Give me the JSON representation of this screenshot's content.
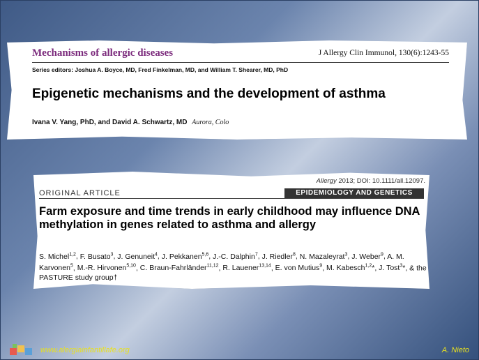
{
  "clip1": {
    "journal": "Mechanisms of allergic diseases",
    "citation": "J Allergy Clin Immunol, 130(6):1243-55",
    "editors": "Series editors: Joshua A. Boyce, MD, Fred Finkelman, MD, and William T. Shearer, MD, PhD",
    "title": "Epigenetic mechanisms and the development of asthma",
    "authors": "Ivana V. Yang, PhD, and David A. Schwartz, MD",
    "affiliation": "Aurora, Colo"
  },
  "clip2": {
    "citation_journal": "Allergy",
    "citation_rest": " 2013; DOI: 10.1111/all.12097.",
    "label": "ORIGINAL ARTICLE",
    "section": "EPIDEMIOLOGY AND GENETICS",
    "title": "Farm exposure and time trends in early childhood may influence DNA methylation in genes related to asthma and allergy",
    "authors": [
      {
        "name": "S. Michel",
        "sup": "1,2"
      },
      {
        "name": "F. Busato",
        "sup": "3"
      },
      {
        "name": "J. Genuneit",
        "sup": "4"
      },
      {
        "name": "J. Pekkanen",
        "sup": "5,6"
      },
      {
        "name": "J.-C. Dalphin",
        "sup": "7"
      },
      {
        "name": "J. Riedler",
        "sup": "8"
      },
      {
        "name": "N. Mazaleyrat",
        "sup": "3"
      },
      {
        "name": "J. Weber",
        "sup": "9"
      },
      {
        "name": "A. M. Karvonen",
        "sup": "5"
      },
      {
        "name": "M.-R. Hirvonen",
        "sup": "5,10"
      },
      {
        "name": "C. Braun-Fahrländer",
        "sup": "11,12"
      },
      {
        "name": "R. Lauener",
        "sup": "13,14"
      },
      {
        "name": "E. von Mutius",
        "sup": "9"
      },
      {
        "name": "M. Kabesch",
        "sup": "1,2",
        "mark": "*"
      },
      {
        "name": "J. Tost",
        "sup": "3",
        "mark": "*"
      }
    ],
    "authors_tail": "& the PASTURE study group†"
  },
  "footer": {
    "url": "www.alergiainfantillafe.org",
    "author": "A. Nieto"
  },
  "colors": {
    "journal": "#7b2a7c",
    "footer_text": "#e8e020",
    "background": "#5a729c"
  }
}
